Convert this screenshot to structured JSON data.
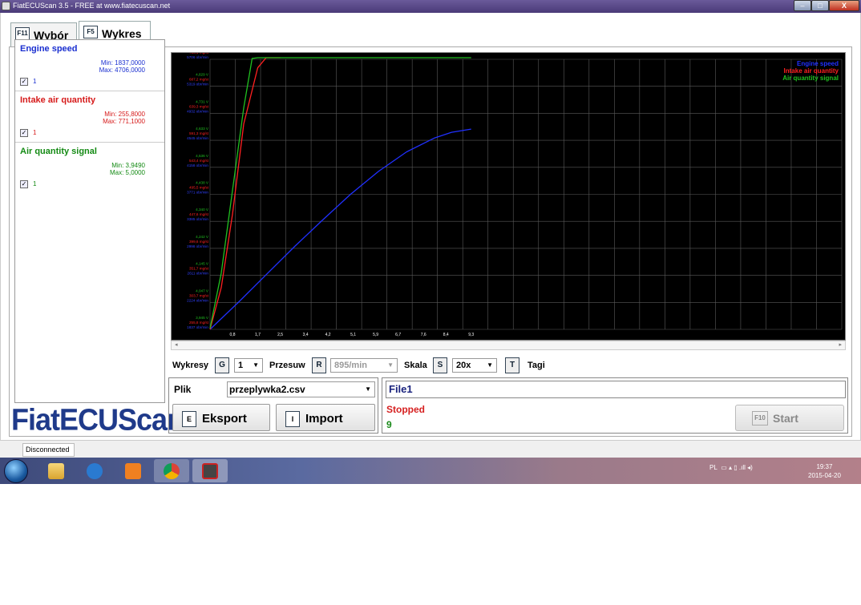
{
  "window": {
    "title": "FiatECUScan 3.5 - FREE at www.fiatecuscan.net",
    "min_label": "–",
    "max_label": "□",
    "close_label": "X"
  },
  "tabs": [
    {
      "key": "F11",
      "label": "Wybór"
    },
    {
      "key": "F5",
      "label": "Wykres"
    }
  ],
  "legend": [
    {
      "name": "Engine speed",
      "min": "Min: 1837,0000",
      "max": "Max: 4706,0000",
      "checked": true,
      "value": "1",
      "color": "#1a2fd0"
    },
    {
      "name": "Intake air quantity",
      "min": "Min: 255,8000",
      "max": "Max: 771,1000",
      "checked": true,
      "value": "1",
      "color": "#d61a1a"
    },
    {
      "name": "Air quantity signal",
      "min": "Min: 3,9490",
      "max": "Max: 5,0000",
      "checked": true,
      "value": "1",
      "color": "#138a13"
    }
  ],
  "logo": "FiatECUScan",
  "chart_data": {
    "type": "line",
    "background": "#000000",
    "grid": true,
    "legend_position": "top-right",
    "x_ticks": [
      "0,8",
      "1,7",
      "2,5",
      "3,4",
      "4,2",
      "5,1",
      "5,9",
      "6,7",
      "7,6",
      "8,4",
      "9,3"
    ],
    "y_ticks": [
      [
        "3,945 V",
        "255,8 mg/st",
        "1837 obr/min"
      ],
      [
        "4,047 V",
        "303,7 mg/st",
        "2224 obr/min"
      ],
      [
        "4,145 V",
        "351,7 mg/st",
        "2611 obr/min"
      ],
      [
        "4,242 V",
        "399,6 mg/st",
        "2998 obr/min"
      ],
      [
        "4,340 V",
        "447,6 mg/st",
        "3385 obr/min"
      ],
      [
        "4,438 V",
        "495,5 mg/st",
        "3771 obr/min"
      ],
      [
        "4,536 V",
        "543,4 mg/st",
        "4158 obr/min"
      ],
      [
        "4,633 V",
        "591,3 mg/st",
        "4545 obr/min"
      ],
      [
        "4,731 V",
        "639,3 mg/st",
        "4932 obr/min"
      ],
      [
        "4,829 V",
        "687,2 mg/st",
        "5319 obr/min"
      ],
      [
        "4,927 V",
        "735,1 mg/st",
        "5706 obr/min"
      ]
    ],
    "x_range": [
      0,
      22.5
    ],
    "series": [
      {
        "name": "Engine speed",
        "color": "#2030ff",
        "x": [
          0,
          1.0,
          2.0,
          3.0,
          4.0,
          5.0,
          6.0,
          7.0,
          8.0,
          8.6,
          9.3
        ],
        "y": [
          1837,
          2220,
          2620,
          3020,
          3400,
          3770,
          4100,
          4380,
          4580,
          4660,
          4706
        ]
      },
      {
        "name": "Intake air quantity",
        "color": "#ff2020",
        "x": [
          0,
          0.4,
          0.8,
          1.2,
          1.7,
          2.0,
          2.5
        ],
        "y": [
          255.8,
          330,
          460,
          620,
          720,
          755,
          771.1
        ]
      },
      {
        "name": "Air quantity signal",
        "color": "#20c020",
        "x": [
          0,
          0.4,
          0.8,
          1.2,
          1.5,
          1.7,
          2.5,
          9.3
        ],
        "y": [
          3.949,
          4.15,
          4.45,
          4.75,
          4.93,
          5.0,
          5.0,
          5.0
        ]
      }
    ]
  },
  "toolbar": {
    "wykresy_label": "Wykresy",
    "wykresy_key": "G",
    "wykresy_value": "1",
    "przesuw_label": "Przesuw",
    "przesuw_key": "R",
    "przesuw_value": "895/min",
    "skala_label": "Skala",
    "skala_key": "S",
    "skala_value": "20x",
    "tagi_key": "T",
    "tagi_label": "Tagi"
  },
  "plik": {
    "label": "Plik",
    "value": "przeplywka2.csv",
    "export_key": "E",
    "export_label": "Eksport",
    "import_key": "I",
    "import_label": "Import"
  },
  "status": {
    "file": "File1",
    "state": "Stopped",
    "count": "9",
    "start_key": "F10",
    "start_label": "Start"
  },
  "statusbar": {
    "connection": "Disconnected"
  },
  "taskbar": {
    "lang": "PL",
    "time": "19:37",
    "date": "2015-04-20"
  }
}
